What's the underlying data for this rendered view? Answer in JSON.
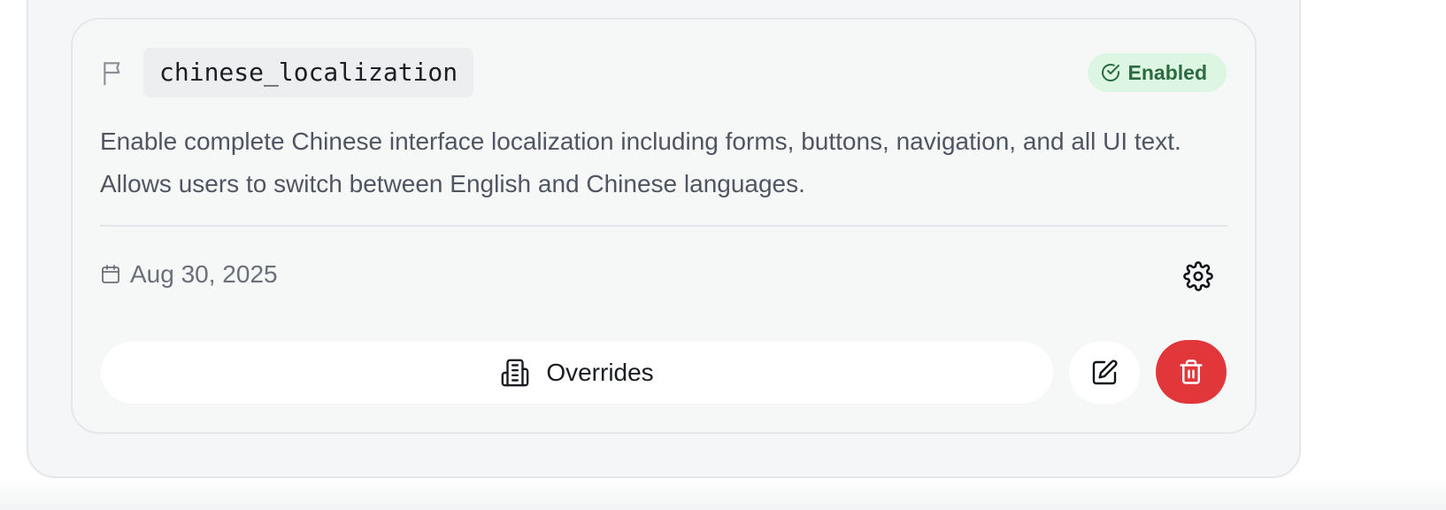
{
  "feature_flag": {
    "key": "chinese_localization",
    "status": "Enabled",
    "description": "Enable complete Chinese interface localization including forms, buttons, navigation, and all UI text. Allows users to switch between English and Chinese languages.",
    "date": "Aug 30, 2025",
    "actions": {
      "overrides_label": "Overrides"
    }
  },
  "icons": {
    "flag": "flag-icon",
    "status": "check-circle-icon",
    "date": "calendar-icon",
    "settings": "gear-icon",
    "overrides": "building-icon",
    "edit": "edit-icon",
    "delete": "trash-icon"
  },
  "colors": {
    "status_bg": "#dcf6e3",
    "status_text": "#2c6b3f",
    "delete_bg": "#e2373a",
    "card_bg": "#f6f7f7"
  }
}
